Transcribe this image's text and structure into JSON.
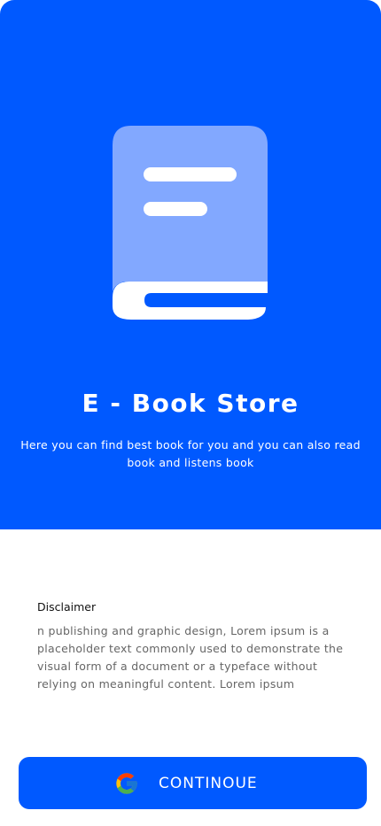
{
  "colors": {
    "primary": "#0059ff",
    "book_cover": "#82a8ff",
    "white": "#ffffff",
    "disclaimer_title": "#111111",
    "disclaimer_text": "#666666"
  },
  "hero": {
    "logo_icon": "book-icon",
    "title": "E - Book Store",
    "subtitle": "Here you can find best book for you and you can also read book and listens book"
  },
  "disclaimer": {
    "title": "Disclaimer",
    "body": "n publishing and graphic design, Lorem ipsum is a placeholder text commonly used to demonstrate the visual form of a document or a typeface without relying on meaningful content. Lorem ipsum"
  },
  "continue_button": {
    "icon": "google-icon",
    "label": "CONTINOUE"
  }
}
